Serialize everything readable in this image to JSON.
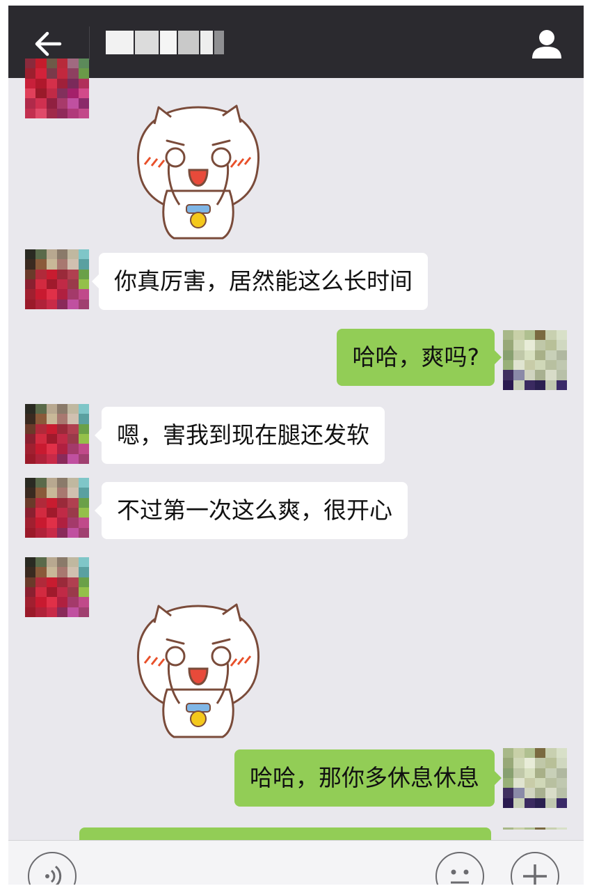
{
  "header": {
    "back_icon": "arrow-left-icon",
    "contact_icon": "person-icon"
  },
  "messages": [
    {
      "side": "left",
      "type": "sticker",
      "sticker": "cat-covering-face-sticker"
    },
    {
      "side": "left",
      "type": "text",
      "text": "你真厉害，居然能这么长时间"
    },
    {
      "side": "right",
      "type": "text",
      "text": "哈哈，爽吗?"
    },
    {
      "side": "left",
      "type": "text",
      "text": "嗯，害我到现在腿还发软"
    },
    {
      "side": "left",
      "type": "text",
      "text": "不过第一次这么爽，很开心"
    },
    {
      "side": "left",
      "type": "sticker",
      "sticker": "cat-covering-face-sticker"
    },
    {
      "side": "right",
      "type": "text",
      "text": "哈哈，那你多休息休息"
    }
  ],
  "inputbar": {
    "voice_icon": "voice-icon",
    "emoji_icon": "emoji-icon",
    "plus_icon": "plus-icon"
  },
  "colors": {
    "header_bg": "#2b2a2f",
    "chat_bg": "#e9e8ed",
    "incoming_bubble": "#ffffff",
    "outgoing_bubble": "#92cd56"
  }
}
